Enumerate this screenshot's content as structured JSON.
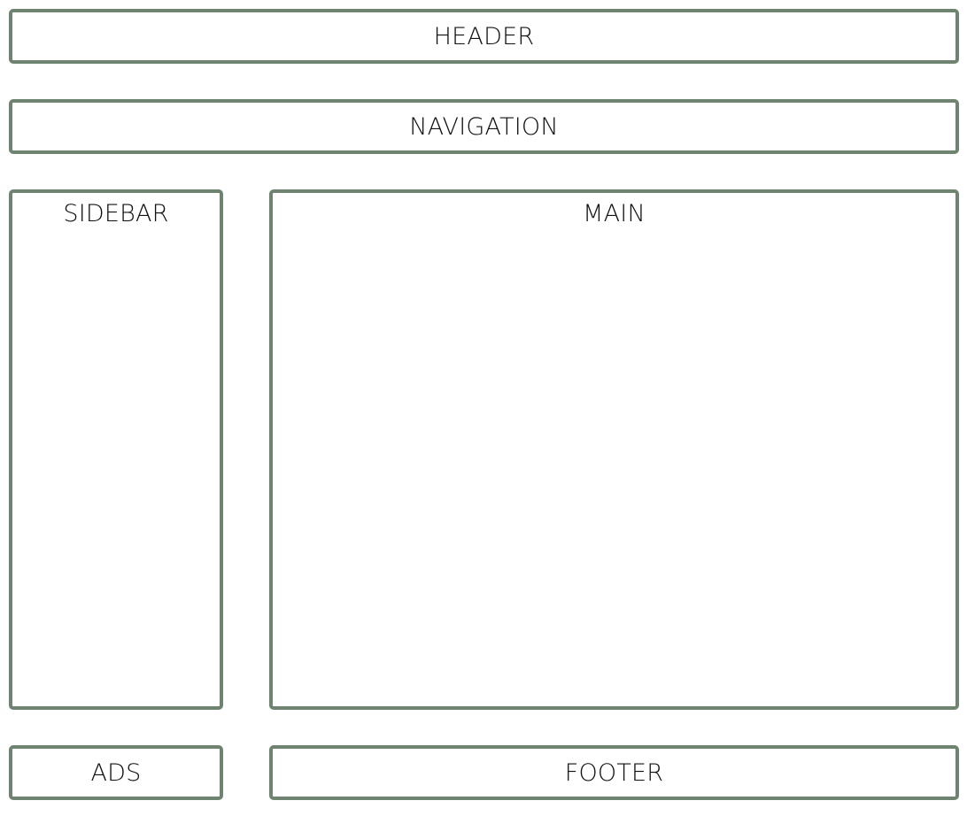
{
  "colors": {
    "border": "#6e8370",
    "text": "#111111",
    "background": "#ffffff"
  },
  "regions": {
    "header": "HEADER",
    "navigation": "NAVIGATION",
    "sidebar": "SIDEBAR",
    "main": "MAIN",
    "ads": "ADS",
    "footer": "FOOTER"
  }
}
